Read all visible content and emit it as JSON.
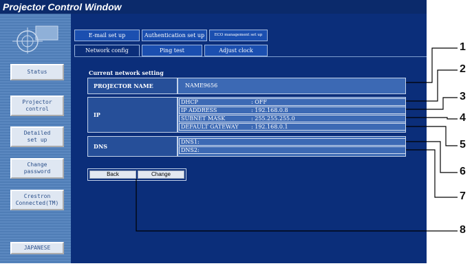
{
  "window": {
    "title": "Projector Control Window"
  },
  "sidebar": {
    "buttons": [
      {
        "label": "Status"
      },
      {
        "label": "Projector\ncontrol"
      },
      {
        "label": "Detailed\nset up"
      },
      {
        "label": "Change\npassword"
      },
      {
        "label": "Crestron\nConnected(TM)"
      },
      {
        "label": "JAPANESE"
      }
    ]
  },
  "tabs": {
    "row1": [
      "E-mail set up",
      "Authentication set up",
      "ECO management set up"
    ],
    "row2": [
      "Network config",
      "Ping test",
      "Adjust clock"
    ],
    "active": "Network config"
  },
  "section": {
    "title": "Current network setting"
  },
  "settings": {
    "projector_name_label": "PROJECTOR NAME",
    "projector_name_value": "NAME9656",
    "ip_label": "IP",
    "ip_rows": [
      {
        "key": "DHCP",
        "value": ": OFF"
      },
      {
        "key": "IP ADDRESS",
        "value": ": 192.168.0.8"
      },
      {
        "key": "SUBNET MASK",
        "value": ": 255.255.255.0"
      },
      {
        "key": "DEFAULT GATEWAY",
        "value": ": 192.168.0.1"
      }
    ],
    "dns_label": "DNS",
    "dns_rows": [
      {
        "key": "DNS1:",
        "value": ""
      },
      {
        "key": "DNS2:",
        "value": ""
      }
    ]
  },
  "buttons": {
    "back": "Back",
    "change": "Change"
  },
  "callouts": [
    "1",
    "2",
    "3",
    "4",
    "5",
    "6",
    "7",
    "8"
  ]
}
